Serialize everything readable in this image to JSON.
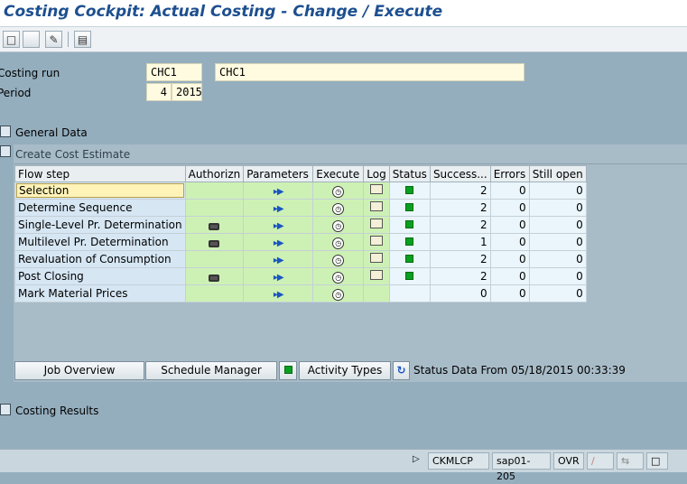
{
  "window": {
    "title": "Costing Cockpit: Actual Costing - Change / Execute"
  },
  "toolbar": {
    "icons": [
      "new-document-icon",
      "blank-icon",
      "edit-pencil-icon",
      "display-icon"
    ]
  },
  "header": {
    "costing_run_label": "Costing run",
    "costing_run_value": "CHC1",
    "costing_run_desc": "CHC1",
    "period_label": "Period",
    "period_value": "4",
    "year_value": "2015"
  },
  "sections": {
    "general_data": "General Data",
    "create_cost_estimate": "Create Cost Estimate",
    "costing_results": "Costing Results"
  },
  "table": {
    "headers": [
      "Flow step",
      "Authorizn",
      "Parameters",
      "Execute",
      "Log",
      "Status",
      "Success...",
      "Errors",
      "Still open"
    ],
    "rows": [
      {
        "step": "Selection",
        "lock": false,
        "params": true,
        "exec": true,
        "log": true,
        "status": true,
        "success": "2",
        "errors": "0",
        "open": "0"
      },
      {
        "step": "Determine Sequence",
        "lock": false,
        "params": true,
        "exec": true,
        "log": true,
        "status": true,
        "success": "2",
        "errors": "0",
        "open": "0"
      },
      {
        "step": "Single-Level Pr. Determination",
        "lock": true,
        "params": true,
        "exec": true,
        "log": true,
        "status": true,
        "success": "2",
        "errors": "0",
        "open": "0"
      },
      {
        "step": "Multilevel Pr. Determination",
        "lock": true,
        "params": true,
        "exec": true,
        "log": true,
        "status": true,
        "success": "1",
        "errors": "0",
        "open": "0"
      },
      {
        "step": "Revaluation of Consumption",
        "lock": false,
        "params": true,
        "exec": true,
        "log": true,
        "status": true,
        "success": "2",
        "errors": "0",
        "open": "0"
      },
      {
        "step": "Post Closing",
        "lock": true,
        "params": true,
        "exec": true,
        "log": true,
        "status": true,
        "success": "2",
        "errors": "0",
        "open": "0"
      },
      {
        "step": "Mark Material Prices",
        "lock": false,
        "params": true,
        "exec": true,
        "log": false,
        "status": false,
        "success": "0",
        "errors": "0",
        "open": "0"
      }
    ]
  },
  "buttons": {
    "job_overview": "Job Overview",
    "schedule_manager": "Schedule Manager",
    "activity_types": "Activity Types"
  },
  "status_text": "Status Data From 05/18/2015 00:33:39",
  "statusbar": {
    "transaction": "CKMLCP",
    "server": "sap01-205",
    "mode": "OVR"
  },
  "colors": {
    "title": "#1d4f8f",
    "background": "#94aebe",
    "status_green": "#08a020"
  }
}
